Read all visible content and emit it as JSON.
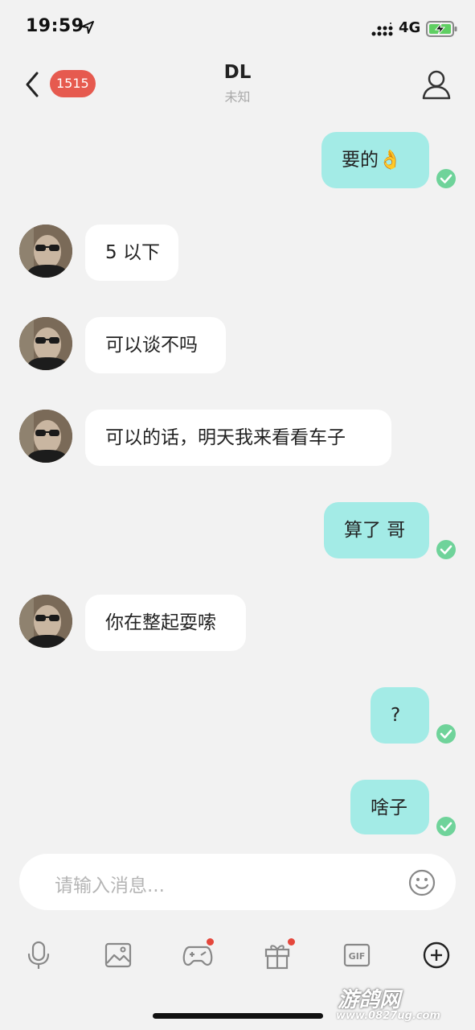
{
  "status_bar": {
    "time": "19:59",
    "network": "4G"
  },
  "header": {
    "unread_count": "1515",
    "title": "DL",
    "subtitle": "未知"
  },
  "messages": [
    {
      "dir": "out",
      "text": "要的👌",
      "status": "read"
    },
    {
      "dir": "in",
      "text": "5 以下"
    },
    {
      "dir": "in",
      "text": "可以谈不吗"
    },
    {
      "dir": "in",
      "text": "可以的话，明天我来看看车子"
    },
    {
      "dir": "out",
      "text": "算了 哥",
      "status": "read"
    },
    {
      "dir": "in",
      "text": "你在整起耍嗦"
    },
    {
      "dir": "out",
      "text": "?",
      "status": "read"
    },
    {
      "dir": "out",
      "text": "啥子",
      "status": "read"
    }
  ],
  "input": {
    "placeholder": "请输入消息..."
  },
  "toolbar": [
    {
      "icon": "microphone-icon"
    },
    {
      "icon": "image-icon"
    },
    {
      "icon": "gamepad-icon",
      "badge_dot": true
    },
    {
      "icon": "gift-icon",
      "badge_dot": true
    },
    {
      "icon": "gif-icon"
    },
    {
      "icon": "plus-circle-icon"
    }
  ],
  "watermark": {
    "brand": "游鸽网",
    "url": "www.0827ug.com"
  },
  "colors": {
    "outgoing_bubble": "#a3ebe6",
    "incoming_bubble": "#ffffff",
    "badge": "#e65a4f",
    "read_check": "#6fd39a",
    "background": "#f2f2f2"
  }
}
